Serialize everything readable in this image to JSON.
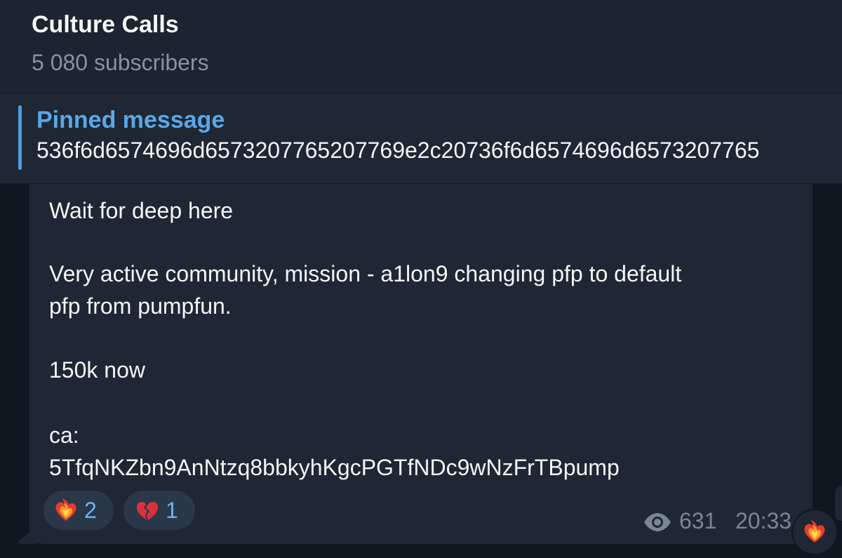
{
  "header": {
    "title": "Culture Calls",
    "subscribers": "5 080 subscribers"
  },
  "pinned": {
    "label": "Pinned message",
    "text": "536f6d6574696d6573207765207769e2c20736f6d6574696d6573207765"
  },
  "message": {
    "line1": "Wait for deep here",
    "line2": "Very active community, mission - a1lon9 changing pfp to default",
    "line3": "pfp from pumpfun.",
    "line4": "150k now",
    "line5": "ca:",
    "line6": "5TfqNKZbn9AnNtzq8bbkyhKgcPGTfNDc9wNzFrTBpump",
    "reactions": [
      {
        "emoji": "heart-on-fire",
        "count": "2"
      },
      {
        "emoji": "broken-heart",
        "count": "1"
      }
    ],
    "views": "631",
    "time": "20:33"
  },
  "colors": {
    "accent": "#4f9ce0",
    "reaction_text": "#6cb4f2"
  }
}
